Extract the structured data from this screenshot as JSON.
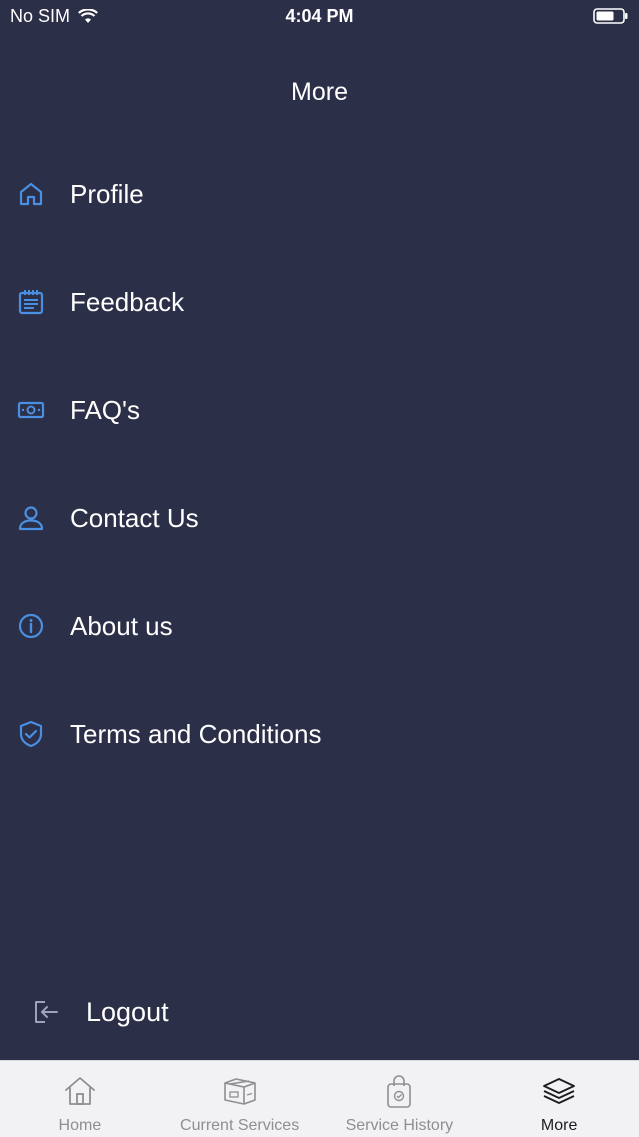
{
  "status_bar": {
    "carrier": "No SIM",
    "time": "4:04 PM",
    "wifi_icon": "wifi-icon",
    "battery_icon": "battery-icon"
  },
  "header": {
    "title": "More"
  },
  "menu": {
    "items": [
      {
        "label": "Profile",
        "icon": "home-icon"
      },
      {
        "label": "Feedback",
        "icon": "notepad-icon"
      },
      {
        "label": "FAQ's",
        "icon": "money-icon"
      },
      {
        "label": "Contact Us",
        "icon": "user-icon"
      },
      {
        "label": "About us",
        "icon": "info-icon"
      },
      {
        "label": "Terms and Conditions",
        "icon": "shield-check-icon"
      }
    ]
  },
  "logout": {
    "label": "Logout",
    "icon": "logout-icon"
  },
  "tab_bar": {
    "tabs": [
      {
        "label": "Home",
        "icon": "home-icon",
        "active": false
      },
      {
        "label": "Current Services",
        "icon": "box-icon",
        "active": false
      },
      {
        "label": "Service History",
        "icon": "bag-icon",
        "active": false
      },
      {
        "label": "More",
        "icon": "layers-icon",
        "active": true
      }
    ]
  },
  "colors": {
    "background": "#2c2f48",
    "accent": "#4a90e2",
    "tab_bar_bg": "#f2f2f4",
    "tab_inactive": "#8e8e93",
    "tab_active": "#1c1c1e"
  }
}
